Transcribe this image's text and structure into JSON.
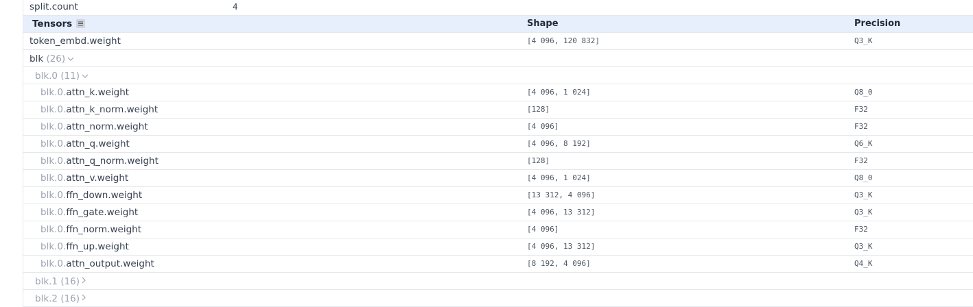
{
  "meta_row": {
    "key": "split.count",
    "value": "4"
  },
  "header": {
    "tensors": "Tensors",
    "shape": "Shape",
    "precision": "Precision"
  },
  "top_tensor": {
    "name": "token_embd.weight",
    "shape": "[4 096, 120 832]",
    "precision": "Q3_K"
  },
  "group": {
    "name": "blk",
    "count": "(26)"
  },
  "subgroup_open": {
    "name": "blk.0",
    "count": "(11)"
  },
  "leaves": [
    {
      "prefix": "blk.0.",
      "name": "attn_k.weight",
      "shape": "[4 096, 1 024]",
      "precision": "Q8_0"
    },
    {
      "prefix": "blk.0.",
      "name": "attn_k_norm.weight",
      "shape": "[128]",
      "precision": "F32"
    },
    {
      "prefix": "blk.0.",
      "name": "attn_norm.weight",
      "shape": "[4 096]",
      "precision": "F32"
    },
    {
      "prefix": "blk.0.",
      "name": "attn_q.weight",
      "shape": "[4 096, 8 192]",
      "precision": "Q6_K"
    },
    {
      "prefix": "blk.0.",
      "name": "attn_q_norm.weight",
      "shape": "[128]",
      "precision": "F32"
    },
    {
      "prefix": "blk.0.",
      "name": "attn_v.weight",
      "shape": "[4 096, 1 024]",
      "precision": "Q8_0"
    },
    {
      "prefix": "blk.0.",
      "name": "ffn_down.weight",
      "shape": "[13 312, 4 096]",
      "precision": "Q3_K"
    },
    {
      "prefix": "blk.0.",
      "name": "ffn_gate.weight",
      "shape": "[4 096, 13 312]",
      "precision": "Q3_K"
    },
    {
      "prefix": "blk.0.",
      "name": "ffn_norm.weight",
      "shape": "[4 096]",
      "precision": "F32"
    },
    {
      "prefix": "blk.0.",
      "name": "ffn_up.weight",
      "shape": "[4 096, 13 312]",
      "precision": "Q3_K"
    },
    {
      "prefix": "blk.0.",
      "name": "attn_output.weight",
      "shape": "[8 192, 4 096]",
      "precision": "Q4_K"
    }
  ],
  "collapsed_groups": [
    {
      "name": "blk.1",
      "count": "(16)"
    },
    {
      "name": "blk.2",
      "count": "(16)"
    }
  ],
  "icons": {
    "menu": "menu-lines-icon",
    "expanded": "chevron-down-icon",
    "collapsed": "chevron-right-icon"
  }
}
